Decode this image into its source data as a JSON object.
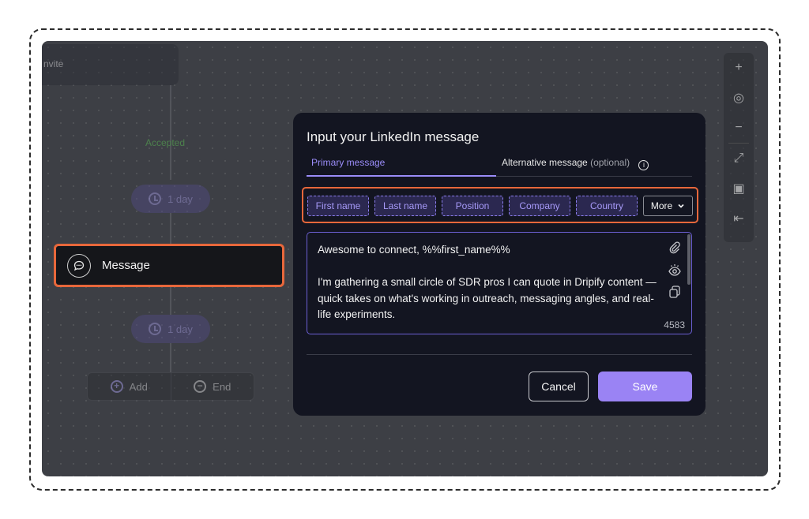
{
  "canvas": {
    "invite_label": "nvite",
    "accepted_label": "Accepted",
    "delays": [
      {
        "label": "1 day"
      },
      {
        "label": "1 day"
      }
    ],
    "add_label": "Add",
    "end_label": "End"
  },
  "message_node": {
    "label": "Message"
  },
  "modal": {
    "title": "Input your LinkedIn message",
    "tabs": {
      "primary": "Primary message",
      "alternative": "Alternative message",
      "alternative_suffix": "(optional)"
    },
    "variables": [
      "First name",
      "Last name",
      "Position",
      "Company",
      "Country"
    ],
    "more_label": "More",
    "message": {
      "line1": "Awesome to connect, %%first_name%%",
      "body": "I'm gathering a small circle of SDR pros I can quote in Dripify content — quick takes on what's working in outreach, messaging angles, and real-life experiments."
    },
    "char_count": "4583",
    "cancel_label": "Cancel",
    "save_label": "Save"
  },
  "colors": {
    "accent": "#9a83f4",
    "highlight": "#e8673b",
    "success": "#5fcf55"
  }
}
